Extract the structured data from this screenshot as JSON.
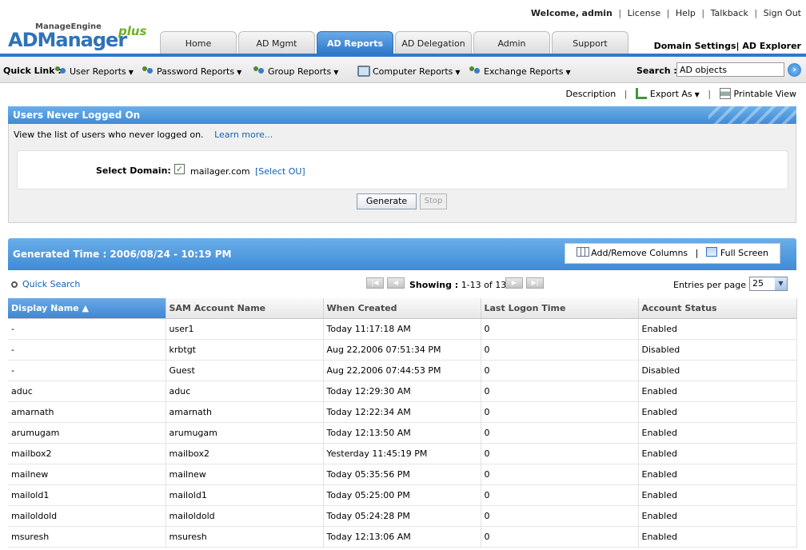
{
  "header": {
    "brand_top": "ManageEngine",
    "brand_main": "ADManager",
    "brand_plus": "plus",
    "welcome": "Welcome,",
    "user": "admin",
    "links": [
      "License",
      "Help",
      "Talkback",
      "Sign Out"
    ],
    "tabs": [
      {
        "label": "Home",
        "active": false
      },
      {
        "label": "AD Mgmt",
        "active": false
      },
      {
        "label": "AD Reports",
        "active": true
      },
      {
        "label": "AD Delegation",
        "active": false
      },
      {
        "label": "Admin",
        "active": false
      },
      {
        "label": "Support",
        "active": false
      }
    ],
    "domain_settings": "Domain Settings",
    "ad_explorer": "AD Explorer"
  },
  "quickbar": {
    "label": "Quick Link :",
    "items": [
      {
        "label": "User Reports",
        "icon": "users-icon"
      },
      {
        "label": "Password Reports",
        "icon": "password-icon"
      },
      {
        "label": "Group Reports",
        "icon": "group-icon"
      },
      {
        "label": "Computer Reports",
        "icon": "computer-icon"
      },
      {
        "label": "Exchange Reports",
        "icon": "exchange-icon"
      }
    ],
    "search_label": "Search :",
    "search_value": "AD objects"
  },
  "actions": {
    "description": "Description",
    "export": "Export As",
    "printable": "Printable View"
  },
  "report_panel": {
    "title": "Users Never Logged On",
    "description": "View the list of users who never logged on.",
    "learn_more": "Learn more...",
    "select_domain_label": "Select Domain:",
    "domain": "mailager.com",
    "domain_checked": true,
    "select_ou": "[Select OU]",
    "generate": "Generate",
    "stop": "Stop"
  },
  "results": {
    "generated_time": "Generated Time : 2006/08/24 - 10:19 PM",
    "add_remove_columns": "Add/Remove Columns",
    "full_screen": "Full Screen",
    "quick_search": "Quick Search",
    "showing_label": "Showing :",
    "showing_range": "1-13 of 13",
    "entries_per_page_label": "Entries per page",
    "entries_per_page": "25",
    "columns": [
      "Display Name",
      "SAM Account Name",
      "When Created",
      "Last Logon Time",
      "Account Status"
    ],
    "sort_indicator": "▲",
    "rows": [
      [
        "-",
        "user1",
        "Today 11:17:18 AM",
        "0",
        "Enabled"
      ],
      [
        "-",
        "krbtgt",
        "Aug 22,2006 07:51:34 PM",
        "0",
        "Disabled"
      ],
      [
        "-",
        "Guest",
        "Aug 22,2006 07:44:53 PM",
        "0",
        "Disabled"
      ],
      [
        "aduc",
        "aduc",
        "Today 12:29:30 AM",
        "0",
        "Enabled"
      ],
      [
        "amarnath",
        "amarnath",
        "Today 12:22:34 AM",
        "0",
        "Enabled"
      ],
      [
        "arumugam",
        "arumugam",
        "Today 12:13:50 AM",
        "0",
        "Enabled"
      ],
      [
        "mailbox2",
        "mailbox2",
        "Yesterday 11:45:19 PM",
        "0",
        "Enabled"
      ],
      [
        "mailnew",
        "mailnew",
        "Today 05:35:56 PM",
        "0",
        "Enabled"
      ],
      [
        "mailold1",
        "mailold1",
        "Today 05:25:00 PM",
        "0",
        "Enabled"
      ],
      [
        "mailoldold",
        "mailoldold",
        "Today 05:24:28 PM",
        "0",
        "Enabled"
      ],
      [
        "msuresh",
        "msuresh",
        "Today 12:13:06 AM",
        "0",
        "Enabled"
      ]
    ]
  },
  "colors": {
    "accent": "#2e79cc",
    "link": "#1560b0"
  }
}
